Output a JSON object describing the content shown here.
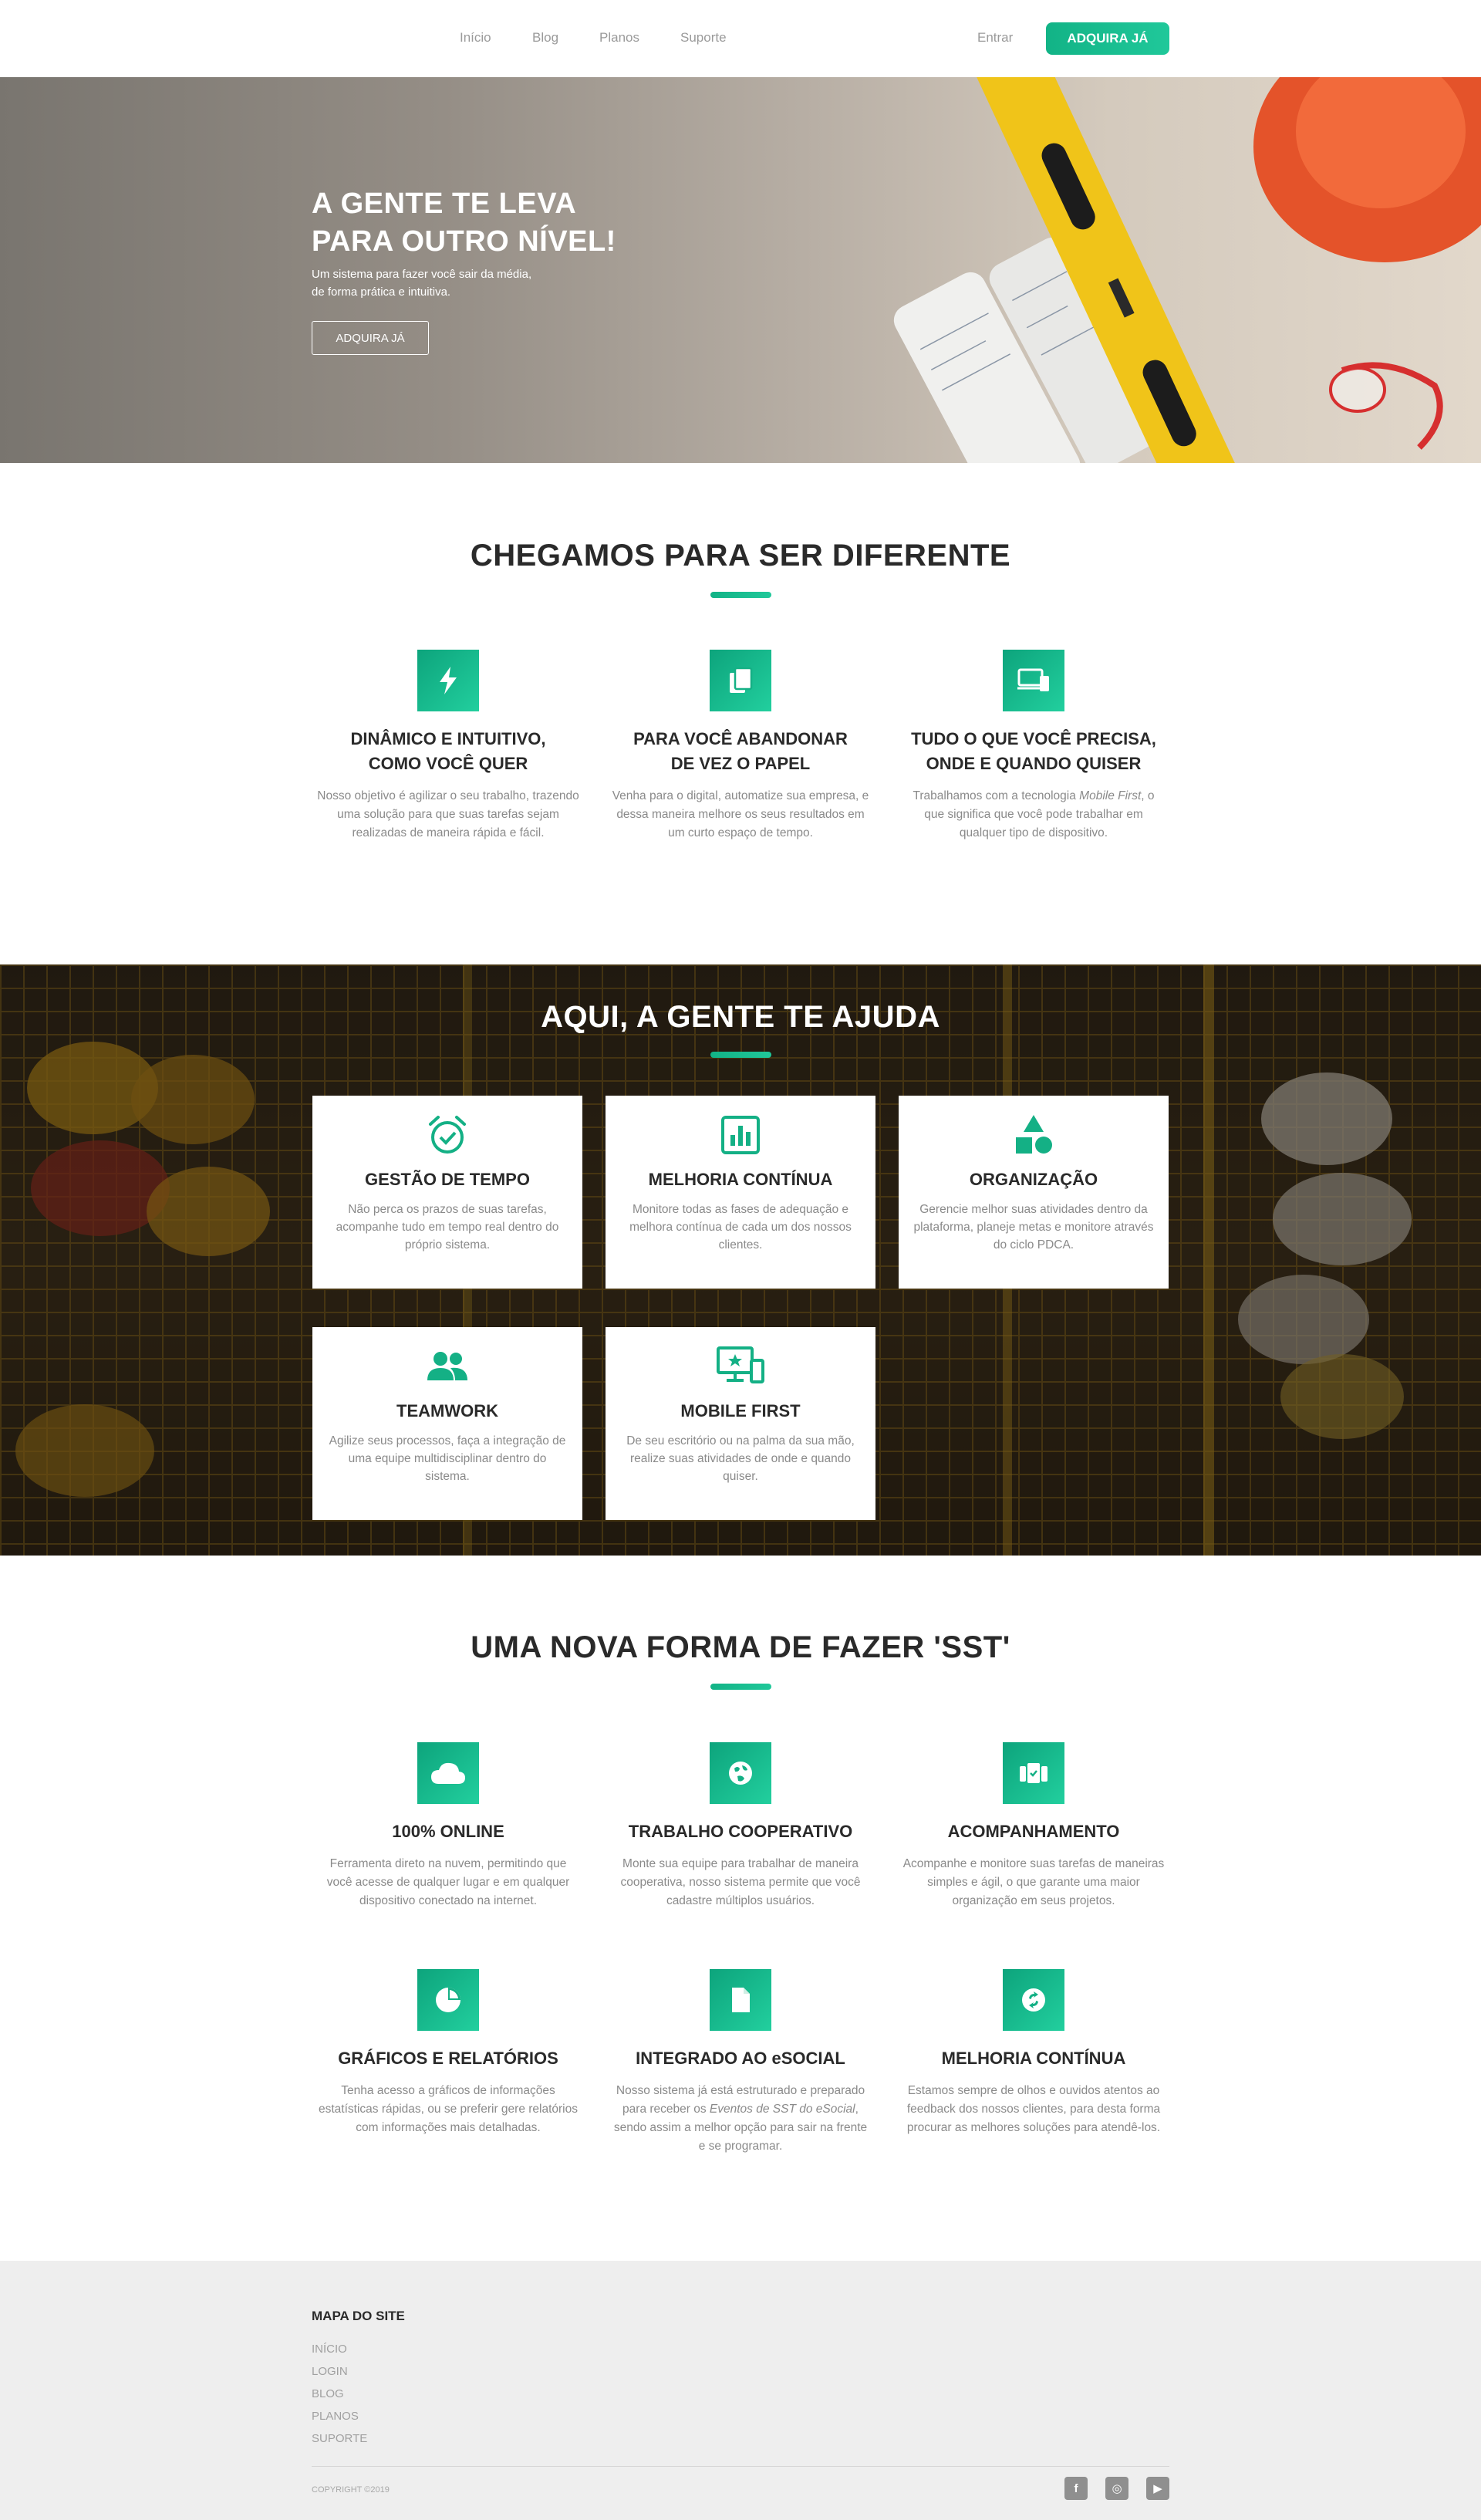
{
  "nav": {
    "links": [
      "Início",
      "Blog",
      "Planos",
      "Suporte"
    ],
    "login": "Entrar",
    "cta": "ADQUIRA JÁ"
  },
  "hero": {
    "title_line1": "A GENTE TE LEVA",
    "title_line2": "PARA OUTRO NÍVEL!",
    "subtitle_line1": "Um sistema para fazer você sair da média,",
    "subtitle_line2": "de forma prática e intuitiva.",
    "button": "ADQUIRA JÁ"
  },
  "section1": {
    "title": "CHEGAMOS PARA SER DIFERENTE",
    "features": [
      {
        "icon": "bolt-icon",
        "title_line1": "DINÂMICO E INTUITIVO,",
        "title_line2": "COMO VOCÊ QUER",
        "desc": "Nosso objetivo é agilizar o seu trabalho, trazendo uma solução para que suas tarefas sejam realizadas de maneira rápida e fácil."
      },
      {
        "icon": "documents-icon",
        "title_line1": "PARA VOCÊ ABANDONAR",
        "title_line2": "DE VEZ O PAPEL",
        "desc": "Venha para o digital, automatize sua empresa, e dessa maneira melhore os seus resultados em um curto espaço de tempo."
      },
      {
        "icon": "devices-icon",
        "title_line1": "TUDO O QUE VOCÊ PRECISA,",
        "title_line2": "ONDE E QUANDO QUISER",
        "desc_pre": "Trabalhamos com a tecnologia ",
        "desc_em": "Mobile First",
        "desc_post": ", o que significa que você pode trabalhar em qualquer tipo de dispositivo."
      }
    ]
  },
  "section2": {
    "title": "AQUI, A GENTE TE AJUDA",
    "cards": [
      {
        "icon": "alarm-check-icon",
        "title": "GESTÃO DE TEMPO",
        "desc": "Não perca os prazos de suas tarefas, acompanhe tudo em tempo real dentro do próprio sistema."
      },
      {
        "icon": "chart-icon",
        "title": "MELHORIA CONTÍNUA",
        "desc": "Monitore todas as fases de adequação e melhora contínua de cada um dos nossos clientes."
      },
      {
        "icon": "shapes-icon",
        "title": "ORGANIZAÇÃO",
        "desc": "Gerencie melhor suas atividades dentro da plataforma, planeje metas e monitore através do ciclo PDCA."
      },
      {
        "icon": "people-icon",
        "title": "TEAMWORK",
        "desc": "Agilize seus processos, faça a integração de uma equipe multidisciplinar dentro do sistema."
      },
      {
        "icon": "devices-star-icon",
        "title": "MOBILE FIRST",
        "desc": "De seu escritório ou na palma da sua mão, realize suas atividades de onde e quando quiser."
      }
    ]
  },
  "section3": {
    "title": "UMA NOVA FORMA DE FAZER 'SST'",
    "features": [
      {
        "icon": "cloud-icon",
        "title": "100% ONLINE",
        "desc": "Ferramenta direto na nuvem, permitindo que você acesse de qualquer lugar e em qualquer dispositivo conectado na internet."
      },
      {
        "icon": "globe-icon",
        "title": "TRABALHO COOPERATIVO",
        "desc": "Monte sua equipe para trabalhar de maneira cooperativa, nosso sistema permite que você cadastre múltiplos usuários."
      },
      {
        "icon": "checklist-icon",
        "title": "ACOMPANHAMENTO",
        "desc": "Acompanhe e monitore suas tarefas de maneiras simples e ágil, o que garante uma maior organização em seus projetos."
      },
      {
        "icon": "pie-chart-icon",
        "title": "GRÁFICOS E RELATÓRIOS",
        "desc": "Tenha acesso a gráficos de informações estatísticas rápidas, ou se preferir gere relatórios com informações mais detalhadas."
      },
      {
        "icon": "file-icon",
        "title": "INTEGRADO AO eSOCIAL",
        "desc_pre": "Nosso sistema já está estruturado e preparado para receber os ",
        "desc_em": "Eventos de SST do eSocial",
        "desc_post": ", sendo assim a melhor opção para sair na frente e se programar."
      },
      {
        "icon": "sync-icon",
        "title": "MELHORIA CONTÍNUA",
        "desc": "Estamos sempre de olhos e ouvidos atentos ao feedback dos nossos clientes, para desta forma procurar as melhores soluções para atendê-los."
      }
    ]
  },
  "footer": {
    "heading": "MAPA DO SITE",
    "links": [
      "INÍCIO",
      "LOGIN",
      "BLOG",
      "PLANOS",
      "SUPORTE"
    ],
    "copyright": "COPYRIGHT ©2019",
    "social": [
      {
        "icon": "facebook-icon",
        "glyph": "f"
      },
      {
        "icon": "instagram-icon",
        "glyph": "◎"
      },
      {
        "icon": "youtube-icon",
        "glyph": "▶"
      }
    ]
  }
}
